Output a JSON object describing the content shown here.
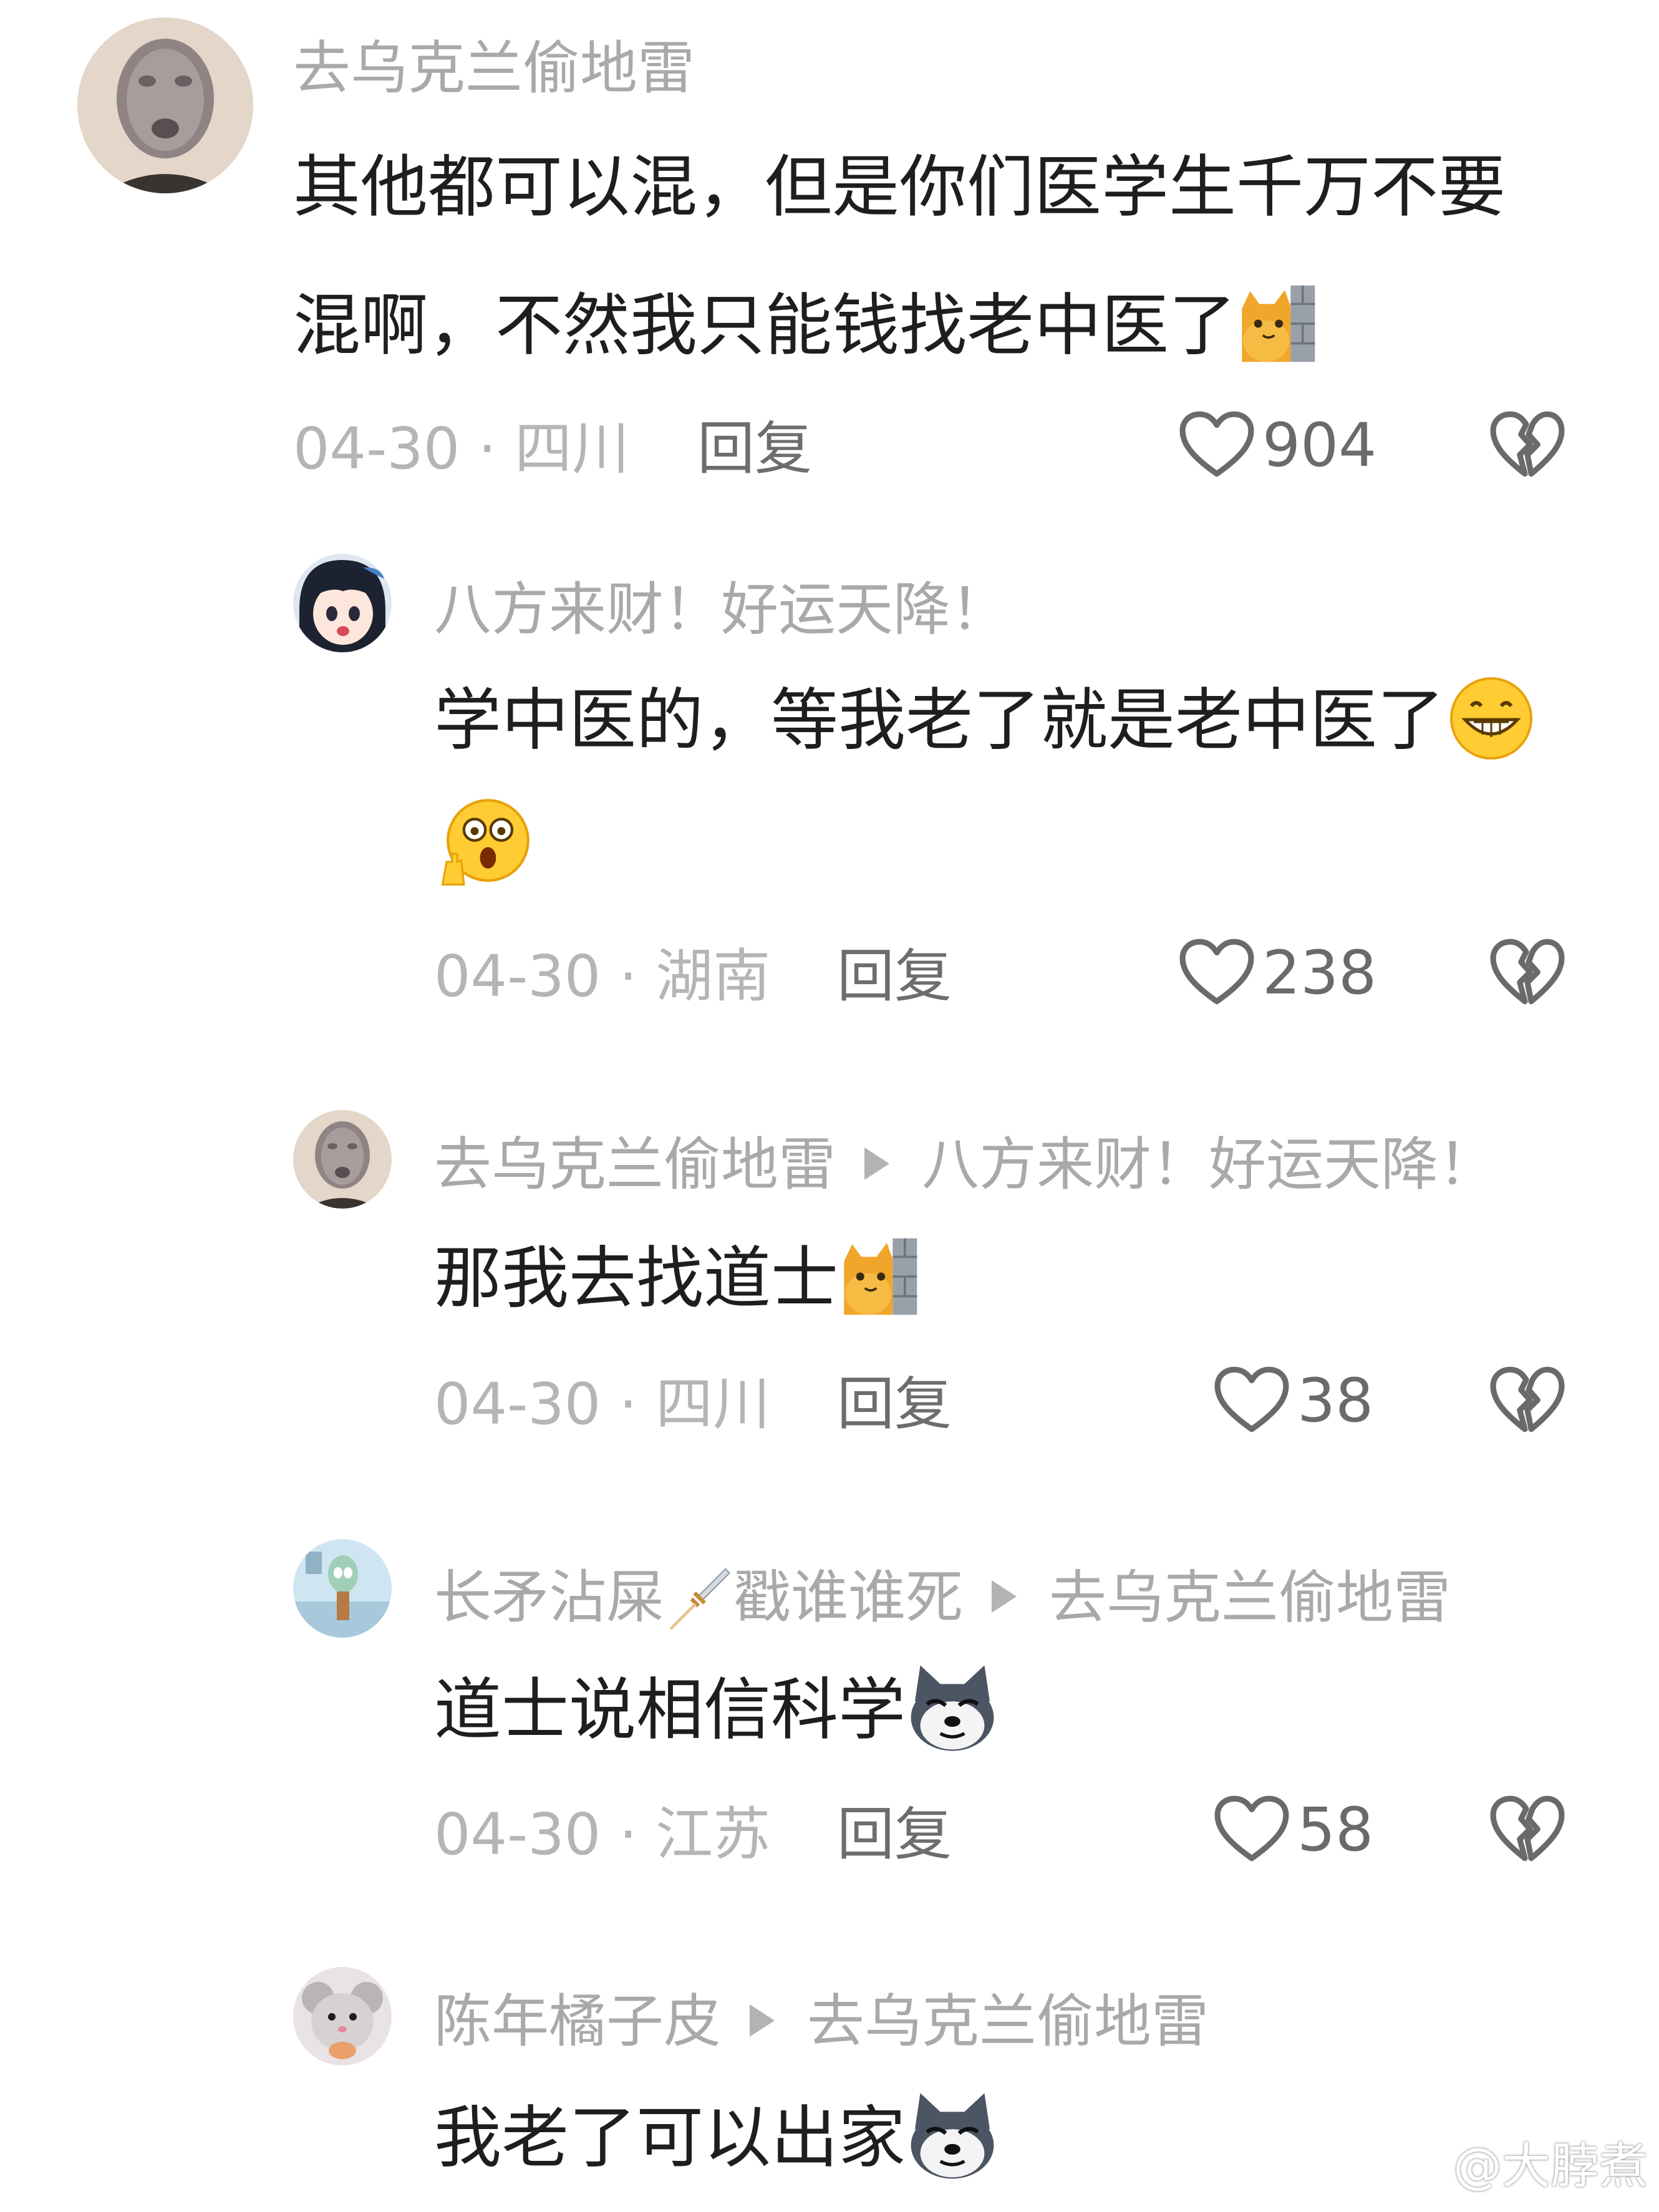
{
  "comments": [
    {
      "author": "去乌克兰偷地雷",
      "reply_to": "",
      "lines": [
        "其他都可以混，但是你们医学生千万不要",
        "混啊，不然我只能钱找老中医了"
      ],
      "date": "04-30",
      "location": "四川",
      "reply_label": "回复",
      "likes": "904",
      "avatar": "masked-face-avatar",
      "emoji": [
        "cat-peek-emoji"
      ]
    },
    {
      "author": "八方来财！好运天降！",
      "reply_to": "",
      "lines": [
        "学中医的，等我老了就是老中医了",
        ""
      ],
      "date": "04-30",
      "location": "湖南",
      "reply_label": "回复",
      "likes": "238",
      "avatar": "anime-girl-avatar",
      "emoji": [
        "grin-emoji",
        "shocked-emoji"
      ]
    },
    {
      "author": "去乌克兰偷地雷",
      "reply_to": "八方来财！好运天降！",
      "lines": [
        "那我去找道士"
      ],
      "date": "04-30",
      "location": "四川",
      "reply_label": "回复",
      "likes": "38",
      "avatar": "masked-face-avatar",
      "emoji": [
        "cat-peek-emoji"
      ]
    },
    {
      "author": "长矛沾屎",
      "author_suffix": "戳谁谁死",
      "reply_to": "去乌克兰偷地雷",
      "lines": [
        "道士说相信科学"
      ],
      "date": "04-30",
      "location": "江苏",
      "reply_label": "回复",
      "likes": "58",
      "avatar": "squidward-avatar",
      "emoji": [
        "sword-emoji",
        "husky-emoji"
      ]
    },
    {
      "author": "陈年橘子皮",
      "reply_to": "去乌克兰偷地雷",
      "lines": [
        "我老了可以出家"
      ],
      "avatar": "mouse-avatar",
      "emoji": [
        "husky-emoji"
      ]
    }
  ],
  "watermark": "@大脖煮",
  "icons": [
    "heart-icon",
    "broken-heart-icon",
    "weibo-logo-icon"
  ],
  "colors": {
    "name": "#a9a9a9",
    "meta": "#b5b5b5",
    "text": "#1e1e1e",
    "reply": "#6d6d6d"
  }
}
